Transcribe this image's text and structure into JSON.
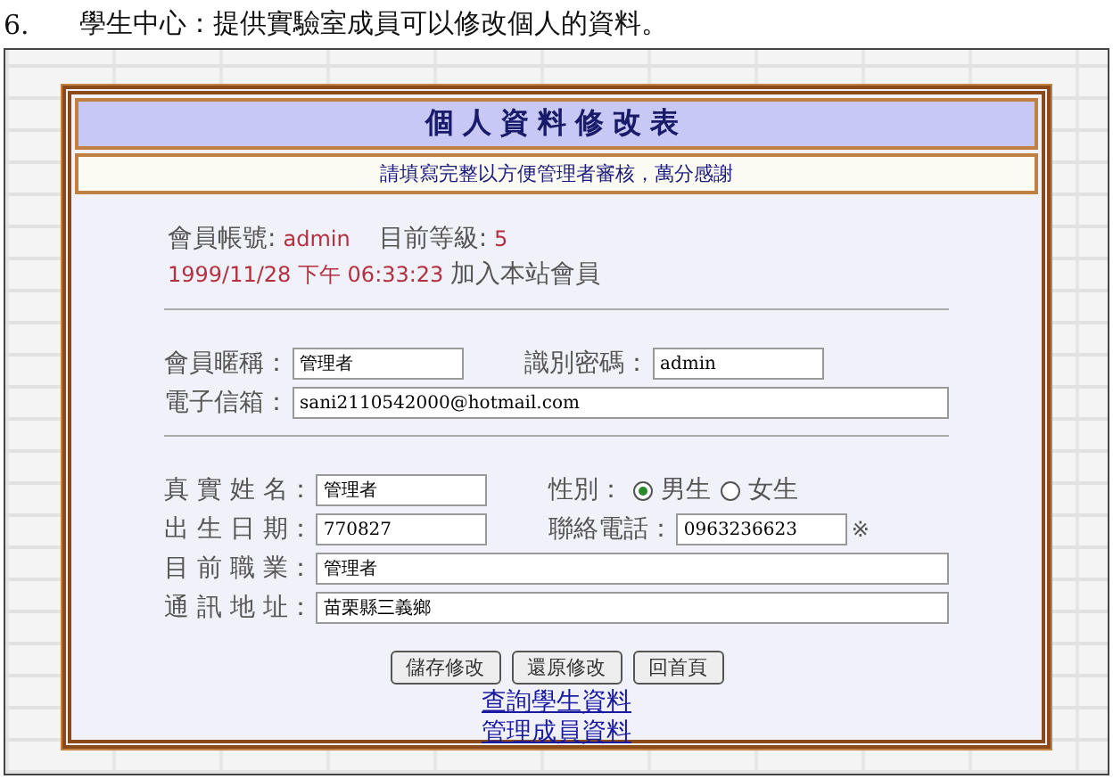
{
  "caption": {
    "number": "6.",
    "text": "學生中心：提供實驗室成員可以修改個人的資料。"
  },
  "form": {
    "title": "個人資料修改表",
    "subtitle": "請填寫完整以方便管理者審核，萬分感謝",
    "account": {
      "label": "會員帳號:",
      "value": "admin",
      "level_label": "目前等級:",
      "level_value": "5",
      "joined": "1999/11/28 下午 06:33:23",
      "joined_label": "加入本站會員"
    },
    "sections": [
      {
        "rows": [
          {
            "items": [
              {
                "kind": "field",
                "label": "會員暱稱：",
                "value": "管理者"
              },
              {
                "kind": "field",
                "label": "識別密碼：",
                "value": "admin"
              }
            ]
          },
          {
            "items": [
              {
                "kind": "field",
                "label": "電子信箱：",
                "value": "sani2110542000@hotmail.com"
              }
            ]
          }
        ]
      },
      {
        "rows": [
          {
            "items": [
              {
                "kind": "field",
                "label": "真 實 姓 名：",
                "value": "管理者"
              },
              {
                "kind": "radio",
                "label": "性別：",
                "options": [
                  {
                    "label": "男生",
                    "selected": true
                  },
                  {
                    "label": "女生",
                    "selected": false
                  }
                ]
              }
            ]
          },
          {
            "items": [
              {
                "kind": "field",
                "label": "出 生 日 期：",
                "value": "770827"
              },
              {
                "kind": "field",
                "label": "聯絡電話：",
                "value": "0963236623",
                "note": "※"
              }
            ]
          },
          {
            "items": [
              {
                "kind": "field",
                "label": "目 前 職 業：",
                "value": "管理者"
              }
            ]
          },
          {
            "items": [
              {
                "kind": "field",
                "label": "通 訊 地 址：",
                "value": "苗栗縣三義鄉"
              }
            ]
          }
        ]
      }
    ],
    "buttons": [
      "儲存修改",
      "還原修改",
      "回首頁"
    ],
    "links": [
      "查詢學生資料",
      "管理成員資料"
    ]
  }
}
